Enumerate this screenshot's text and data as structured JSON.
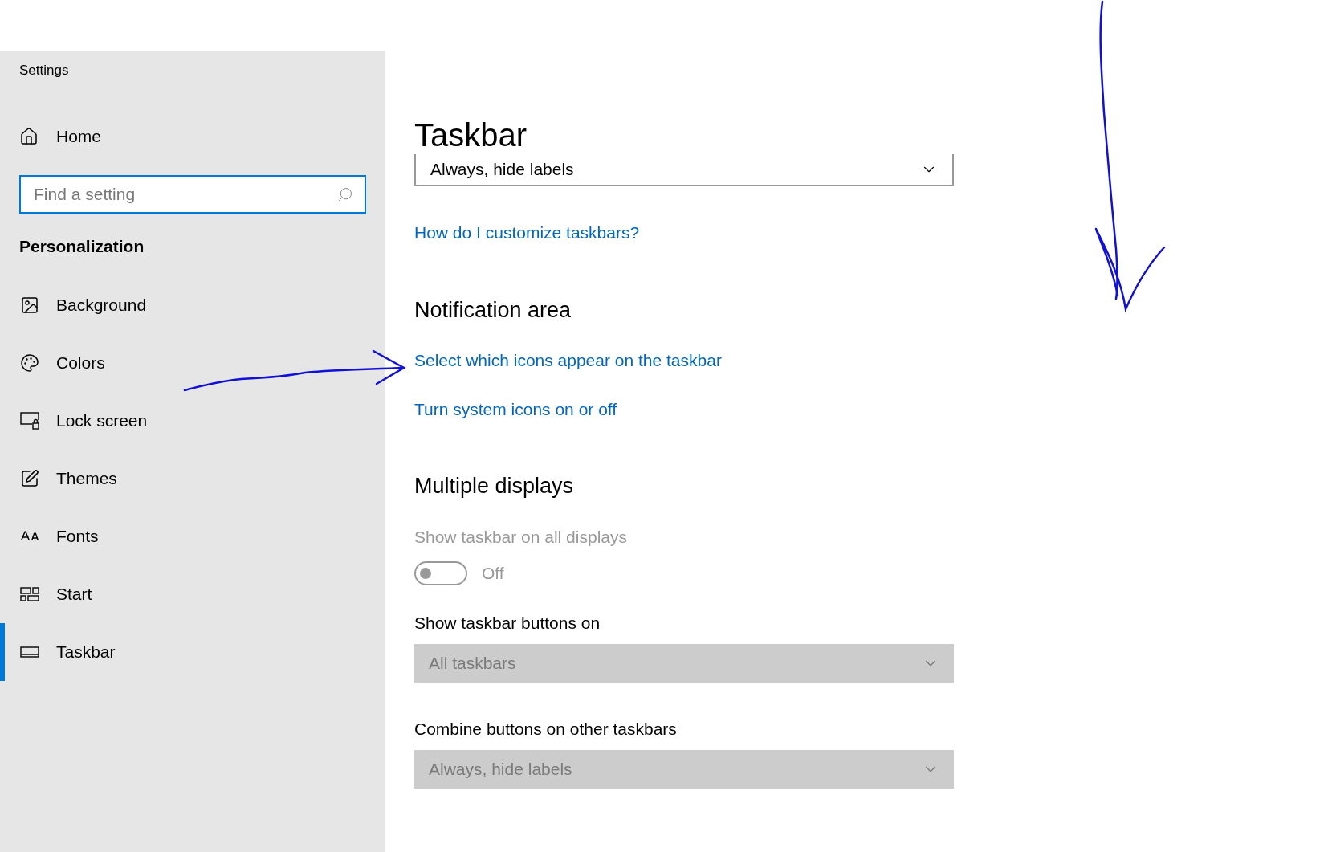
{
  "window": {
    "title": "Settings"
  },
  "sidebar": {
    "home": {
      "label": "Home"
    },
    "search": {
      "placeholder": "Find a setting"
    },
    "section": "Personalization",
    "items": [
      {
        "label": "Background",
        "selected": false
      },
      {
        "label": "Colors",
        "selected": false
      },
      {
        "label": "Lock screen",
        "selected": false
      },
      {
        "label": "Themes",
        "selected": false
      },
      {
        "label": "Fonts",
        "selected": false
      },
      {
        "label": "Start",
        "selected": false
      },
      {
        "label": "Taskbar",
        "selected": true
      }
    ]
  },
  "main": {
    "title": "Taskbar",
    "dropdown": {
      "value": "Always, hide labels",
      "disabled": false
    },
    "help_link": "How do I customize taskbars?",
    "notification_area": {
      "heading": "Notification area",
      "links": [
        "Select which icons appear on the taskbar",
        "Turn system icons on or off"
      ]
    },
    "multiple_displays": {
      "heading": "Multiple displays",
      "toggle_label": "Show taskbar on all displays",
      "toggle": {
        "on": false,
        "disabled": true,
        "state_text": "Off"
      },
      "fields": [
        {
          "label": "Show taskbar buttons on",
          "value": "All taskbars",
          "disabled": true
        },
        {
          "label": "Combine buttons on other taskbars",
          "value": "Always, hide labels",
          "disabled": true
        }
      ]
    }
  }
}
